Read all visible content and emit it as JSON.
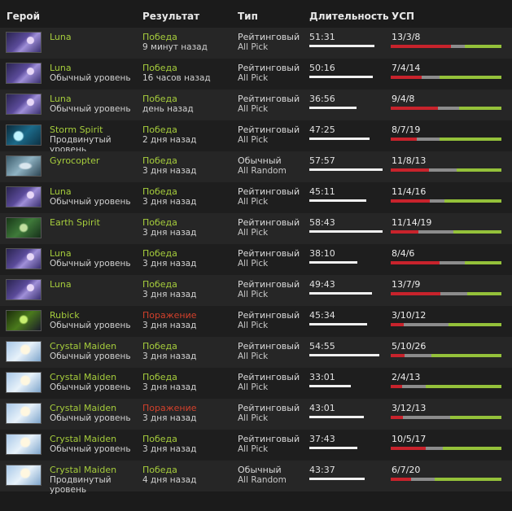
{
  "headers": {
    "hero": "Герой",
    "result": "Результат",
    "type": "Тип",
    "duration": "Длительность",
    "kda": "УСП"
  },
  "colors": {
    "win": "#a6cd3c",
    "loss": "#d2402b",
    "kills": "#c8232c",
    "deaths": "#8c8c8c",
    "assists": "#94c13a"
  },
  "matches": [
    {
      "hero": "Luna",
      "hero_icon": "luna-portrait",
      "skill": "",
      "result": "Победа",
      "outcome": "win",
      "when": "9 минут назад",
      "type": "Рейтинговый",
      "mode": "All Pick",
      "duration": "51:31",
      "duration_fraction": 0.89,
      "kda": "13/3/8",
      "k": 13,
      "d": 3,
      "a": 8
    },
    {
      "hero": "Luna",
      "hero_icon": "luna-portrait",
      "skill": "Обычный уровень",
      "result": "Победа",
      "outcome": "win",
      "when": "16 часов назад",
      "type": "Рейтинговый",
      "mode": "All Pick",
      "duration": "50:16",
      "duration_fraction": 0.87,
      "kda": "7/4/14",
      "k": 7,
      "d": 4,
      "a": 14
    },
    {
      "hero": "Luna",
      "hero_icon": "luna-portrait",
      "skill": "Обычный уровень",
      "result": "Победа",
      "outcome": "win",
      "when": "день назад",
      "type": "Рейтинговый",
      "mode": "All Pick",
      "duration": "36:56",
      "duration_fraction": 0.64,
      "kda": "9/4/8",
      "k": 9,
      "d": 4,
      "a": 8
    },
    {
      "hero": "Storm Spirit",
      "hero_icon": "storm-spirit-portrait",
      "skill": "Продвинутый уровень",
      "result": "Победа",
      "outcome": "win",
      "when": "2 дня назад",
      "type": "Рейтинговый",
      "mode": "All Pick",
      "duration": "47:25",
      "duration_fraction": 0.82,
      "kda": "8/7/19",
      "k": 8,
      "d": 7,
      "a": 19
    },
    {
      "hero": "Gyrocopter",
      "hero_icon": "gyrocopter-portrait",
      "skill": "",
      "result": "Победа",
      "outcome": "win",
      "when": "3 дня назад",
      "type": "Обычный",
      "mode": "All Random",
      "duration": "57:57",
      "duration_fraction": 1.0,
      "kda": "11/8/13",
      "k": 11,
      "d": 8,
      "a": 13
    },
    {
      "hero": "Luna",
      "hero_icon": "luna-portrait",
      "skill": "Обычный уровень",
      "result": "Победа",
      "outcome": "win",
      "when": "3 дня назад",
      "type": "Рейтинговый",
      "mode": "All Pick",
      "duration": "45:11",
      "duration_fraction": 0.78,
      "kda": "11/4/16",
      "k": 11,
      "d": 4,
      "a": 16
    },
    {
      "hero": "Earth Spirit",
      "hero_icon": "earth-spirit-portrait",
      "skill": "",
      "result": "Победа",
      "outcome": "win",
      "when": "3 дня назад",
      "type": "Рейтинговый",
      "mode": "All Pick",
      "duration": "58:43",
      "duration_fraction": 1.0,
      "kda": "11/14/19",
      "k": 11,
      "d": 14,
      "a": 19
    },
    {
      "hero": "Luna",
      "hero_icon": "luna-portrait",
      "skill": "Обычный уровень",
      "result": "Победа",
      "outcome": "win",
      "when": "3 дня назад",
      "type": "Рейтинговый",
      "mode": "All Pick",
      "duration": "38:10",
      "duration_fraction": 0.66,
      "kda": "8/4/6",
      "k": 8,
      "d": 4,
      "a": 6
    },
    {
      "hero": "Luna",
      "hero_icon": "luna-portrait",
      "skill": "",
      "result": "Победа",
      "outcome": "win",
      "when": "3 дня назад",
      "type": "Рейтинговый",
      "mode": "All Pick",
      "duration": "49:43",
      "duration_fraction": 0.86,
      "kda": "13/7/9",
      "k": 13,
      "d": 7,
      "a": 9
    },
    {
      "hero": "Rubick",
      "hero_icon": "rubick-portrait",
      "skill": "Обычный уровень",
      "result": "Поражение",
      "outcome": "loss",
      "when": "3 дня назад",
      "type": "Рейтинговый",
      "mode": "All Pick",
      "duration": "45:34",
      "duration_fraction": 0.79,
      "kda": "3/10/12",
      "k": 3,
      "d": 10,
      "a": 12
    },
    {
      "hero": "Crystal Maiden",
      "hero_icon": "crystal-maiden-portrait",
      "skill": "Обычный уровень",
      "result": "Победа",
      "outcome": "win",
      "when": "3 дня назад",
      "type": "Рейтинговый",
      "mode": "All Pick",
      "duration": "54:55",
      "duration_fraction": 0.95,
      "kda": "5/10/26",
      "k": 5,
      "d": 10,
      "a": 26
    },
    {
      "hero": "Crystal Maiden",
      "hero_icon": "crystal-maiden-portrait",
      "skill": "Обычный уровень",
      "result": "Победа",
      "outcome": "win",
      "when": "3 дня назад",
      "type": "Рейтинговый",
      "mode": "All Pick",
      "duration": "33:01",
      "duration_fraction": 0.57,
      "kda": "2/4/13",
      "k": 2,
      "d": 4,
      "a": 13
    },
    {
      "hero": "Crystal Maiden",
      "hero_icon": "crystal-maiden-portrait",
      "skill": "Обычный уровень",
      "result": "Поражение",
      "outcome": "loss",
      "when": "3 дня назад",
      "type": "Рейтинговый",
      "mode": "All Pick",
      "duration": "43:01",
      "duration_fraction": 0.74,
      "kda": "3/12/13",
      "k": 3,
      "d": 12,
      "a": 13
    },
    {
      "hero": "Crystal Maiden",
      "hero_icon": "crystal-maiden-portrait",
      "skill": "Обычный уровень",
      "result": "Победа",
      "outcome": "win",
      "when": "3 дня назад",
      "type": "Рейтинговый",
      "mode": "All Pick",
      "duration": "37:43",
      "duration_fraction": 0.65,
      "kda": "10/5/17",
      "k": 10,
      "d": 5,
      "a": 17
    },
    {
      "hero": "Crystal Maiden",
      "hero_icon": "crystal-maiden-portrait",
      "skill": "Продвинутый уровень",
      "result": "Победа",
      "outcome": "win",
      "when": "4 дня назад",
      "type": "Обычный",
      "mode": "All Random",
      "duration": "43:37",
      "duration_fraction": 0.75,
      "kda": "6/7/20",
      "k": 6,
      "d": 7,
      "a": 20
    }
  ]
}
